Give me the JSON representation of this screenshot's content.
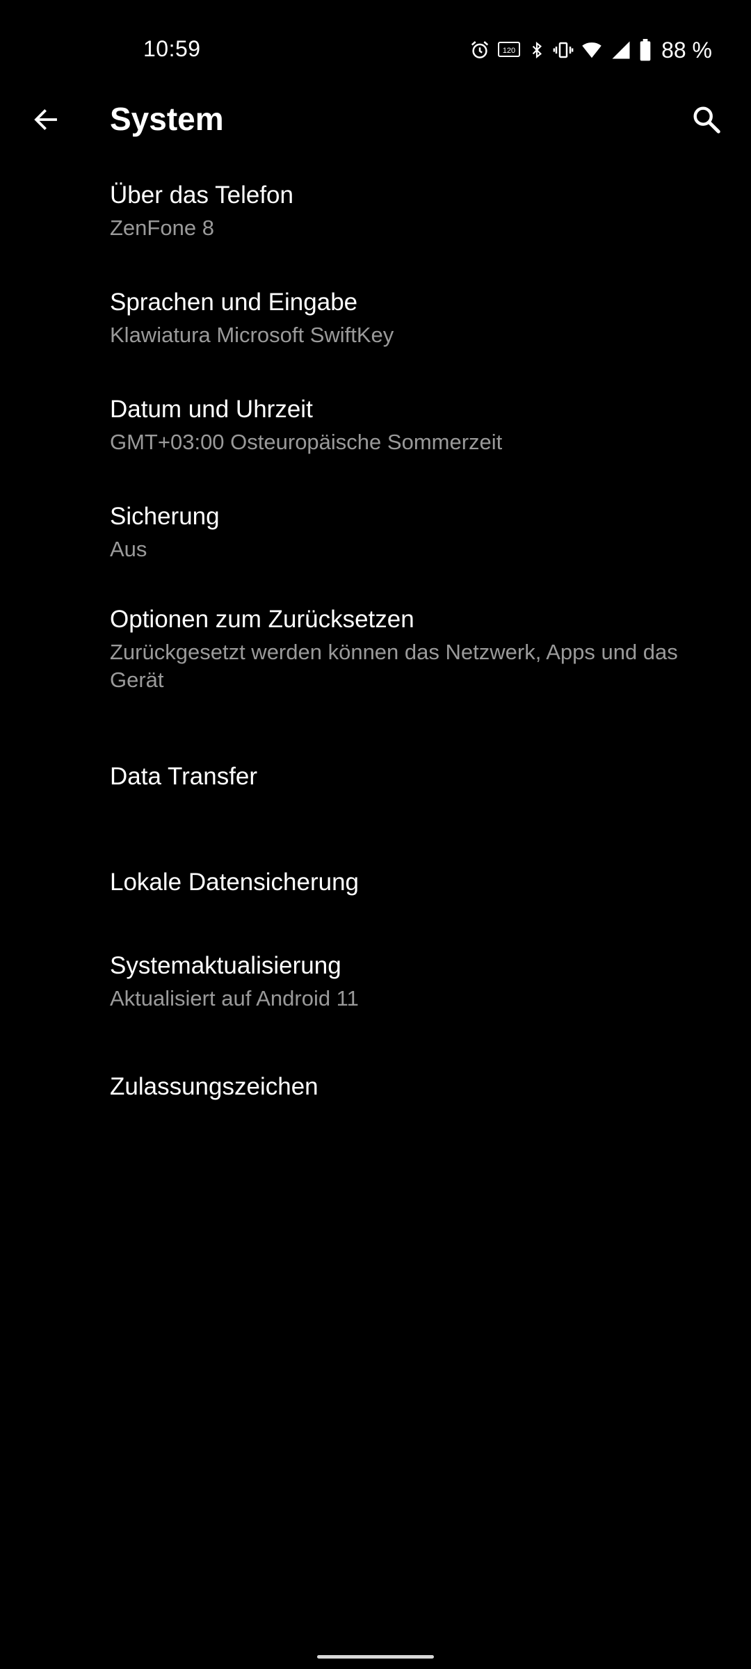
{
  "status_bar": {
    "time": "10:59",
    "battery": "88 %",
    "refresh_badge": "120",
    "icons": [
      "alarm-icon",
      "refresh-rate-icon",
      "bluetooth-icon",
      "vibrate-icon",
      "wifi-icon",
      "signal-icon",
      "battery-icon"
    ]
  },
  "app_bar": {
    "title": "System",
    "back_icon": "back-arrow-icon",
    "search_icon": "search-icon"
  },
  "items": [
    {
      "title": "Über das Telefon",
      "summary": "ZenFone 8"
    },
    {
      "title": "Sprachen und Eingabe",
      "summary": "Klawiatura Microsoft SwiftKey"
    },
    {
      "title": "Datum und Uhrzeit",
      "summary": "GMT+03:00 Osteuropäische Sommerzeit"
    },
    {
      "title": "Sicherung",
      "summary": "Aus"
    },
    {
      "title": "Optionen zum Zurücksetzen",
      "summary": "Zurückgesetzt werden können das Netzwerk, Apps und das Gerät"
    },
    {
      "title": "Data Transfer",
      "summary": ""
    },
    {
      "title": "Lokale Datensicherung",
      "summary": ""
    },
    {
      "title": "Systemaktualisierung",
      "summary": "Aktualisiert auf Android 11"
    },
    {
      "title": "Zulassungszeichen",
      "summary": ""
    }
  ],
  "colors": {
    "background": "#000000",
    "text_primary": "#ffffff",
    "text_secondary": "#9a9a9a"
  }
}
